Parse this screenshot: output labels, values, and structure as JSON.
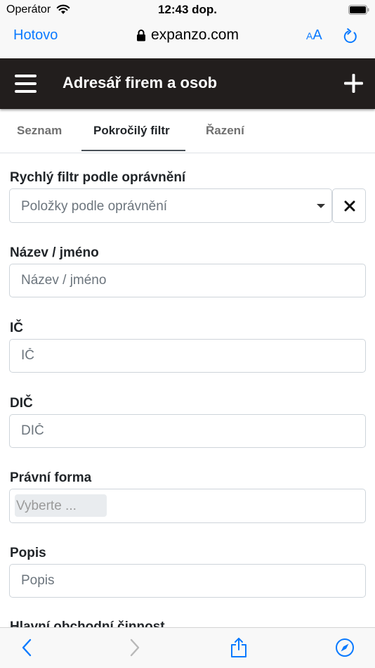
{
  "status_bar": {
    "carrier": "Operátor",
    "time": "12:43 dop."
  },
  "browser": {
    "done_label": "Hotovo",
    "url": "expanzo.com",
    "text_size_small": "A",
    "text_size_large": "A",
    "accent_color": "#0a7aff"
  },
  "app_header": {
    "title": "Adresář firem a osob",
    "background_color": "#221e1d"
  },
  "tabs": [
    {
      "label": "Seznam",
      "active": false
    },
    {
      "label": "Pokročilý filtr",
      "active": true
    },
    {
      "label": "Řazení",
      "active": false
    }
  ],
  "form": {
    "quick_filter": {
      "label": "Rychlý filtr podle oprávnění",
      "placeholder": "Položky podle oprávnění"
    },
    "name": {
      "label": "Název / jméno",
      "placeholder": "Název / jméno",
      "value": ""
    },
    "ic": {
      "label": "IČ",
      "placeholder": "IČ",
      "value": ""
    },
    "dic": {
      "label": "DIČ",
      "placeholder": "DIČ",
      "value": ""
    },
    "legal_form": {
      "label": "Právní forma",
      "placeholder": "Vyberte ..."
    },
    "description": {
      "label": "Popis",
      "placeholder": "Popis",
      "value": ""
    },
    "main_activity": {
      "label": "Hlavní obchodní činnost"
    }
  },
  "icons": {
    "wifi": "wifi-icon",
    "battery": "battery-icon",
    "lock": "lock-icon",
    "reload": "reload-icon",
    "menu": "hamburger-menu-icon",
    "add": "plus-icon",
    "caret": "chevron-down-icon",
    "clear": "close-icon",
    "back": "chevron-left-icon",
    "forward": "chevron-right-icon",
    "share": "share-icon",
    "safari": "compass-icon"
  }
}
